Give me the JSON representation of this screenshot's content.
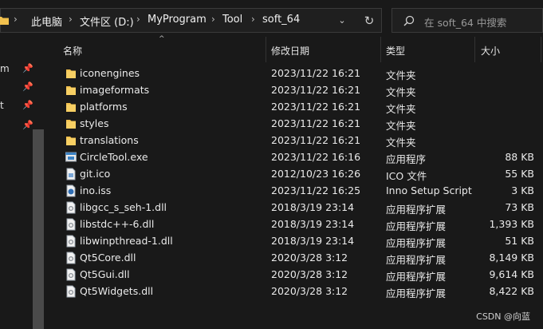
{
  "address": {
    "crumbs": [
      "此电脑",
      "文件区 (D:)",
      "MyProgram",
      "Tool",
      "soft_64"
    ],
    "separator": "›"
  },
  "search": {
    "placeholder": "在 soft_64 中搜索"
  },
  "nav": {
    "items": [
      {
        "label": "m",
        "pin": "📌"
      },
      {
        "label": "",
        "pin": "📌"
      },
      {
        "label": "t",
        "pin": "📌"
      },
      {
        "label": "",
        "pin": "📌"
      }
    ]
  },
  "columns": {
    "name": "名称",
    "modified": "修改日期",
    "type": "类型",
    "size": "大小"
  },
  "files": [
    {
      "name": "iconengines",
      "modified": "2023/11/22 16:21",
      "type": "文件夹",
      "size": "",
      "icon": "folder"
    },
    {
      "name": "imageformats",
      "modified": "2023/11/22 16:21",
      "type": "文件夹",
      "size": "",
      "icon": "folder"
    },
    {
      "name": "platforms",
      "modified": "2023/11/22 16:21",
      "type": "文件夹",
      "size": "",
      "icon": "folder"
    },
    {
      "name": "styles",
      "modified": "2023/11/22 16:21",
      "type": "文件夹",
      "size": "",
      "icon": "folder"
    },
    {
      "name": "translations",
      "modified": "2023/11/22 16:21",
      "type": "文件夹",
      "size": "",
      "icon": "folder"
    },
    {
      "name": "CircleTool.exe",
      "modified": "2023/11/22 16:16",
      "type": "应用程序",
      "size": "88 KB",
      "icon": "exe"
    },
    {
      "name": "git.ico",
      "modified": "2012/10/23 16:26",
      "type": "ICO 文件",
      "size": "55 KB",
      "icon": "ico"
    },
    {
      "name": "ino.iss",
      "modified": "2023/11/22 16:25",
      "type": "Inno Setup Script",
      "size": "3 KB",
      "icon": "iss"
    },
    {
      "name": "libgcc_s_seh-1.dll",
      "modified": "2018/3/19 23:14",
      "type": "应用程序扩展",
      "size": "73 KB",
      "icon": "dll"
    },
    {
      "name": "libstdc++-6.dll",
      "modified": "2018/3/19 23:14",
      "type": "应用程序扩展",
      "size": "1,393 KB",
      "icon": "dll"
    },
    {
      "name": "libwinpthread-1.dll",
      "modified": "2018/3/19 23:14",
      "type": "应用程序扩展",
      "size": "51 KB",
      "icon": "dll"
    },
    {
      "name": "Qt5Core.dll",
      "modified": "2020/3/28 3:12",
      "type": "应用程序扩展",
      "size": "8,149 KB",
      "icon": "dll"
    },
    {
      "name": "Qt5Gui.dll",
      "modified": "2020/3/28 3:12",
      "type": "应用程序扩展",
      "size": "9,614 KB",
      "icon": "dll"
    },
    {
      "name": "Qt5Widgets.dll",
      "modified": "2020/3/28 3:12",
      "type": "应用程序扩展",
      "size": "8,422 KB",
      "icon": "dll"
    }
  ],
  "watermark": "CSDN @向蓝",
  "colors": {
    "folder": "#f2c14e",
    "accent": "#3b82c4",
    "background": "#191919"
  }
}
